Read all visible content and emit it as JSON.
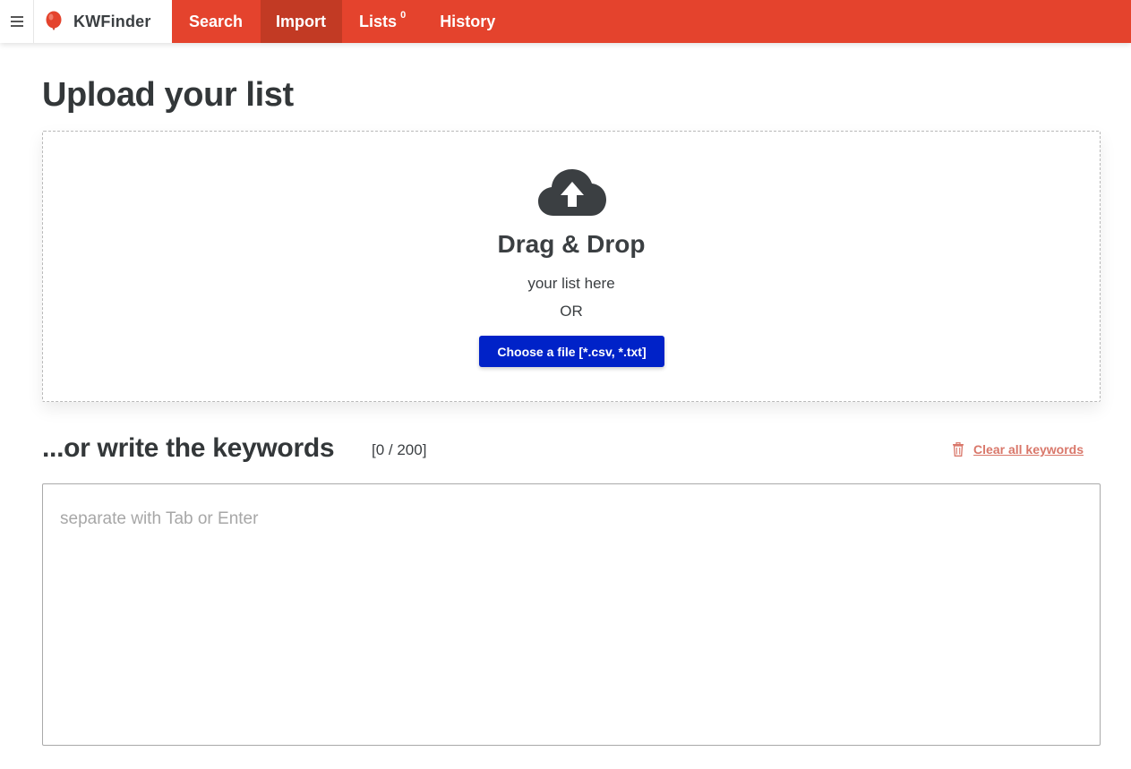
{
  "brand": {
    "name": "KWFinder",
    "accent_color": "#e4432d",
    "logo_icon": "balloon-icon"
  },
  "nav": {
    "menu_icon": "hamburger-menu-icon",
    "tabs": [
      {
        "label": "Search",
        "active": false
      },
      {
        "label": "Import",
        "active": true
      },
      {
        "label": "Lists",
        "badge": "0",
        "active": false
      },
      {
        "label": "History",
        "active": false
      }
    ]
  },
  "upload": {
    "title": "Upload your list",
    "icon": "cloud-upload-icon",
    "dropzone_title": "Drag & Drop",
    "dropzone_subtitle": "your list here",
    "or_text": "OR",
    "choose_button": "Choose a file [*.csv, *.txt]",
    "button_color": "#0022c8"
  },
  "keywords": {
    "heading": "...or write the keywords",
    "count": "[0 / 200]",
    "clear_label": "Clear all keywords",
    "clear_icon": "trash-icon",
    "textarea_value": "",
    "textarea_placeholder": "separate with Tab or Enter"
  }
}
